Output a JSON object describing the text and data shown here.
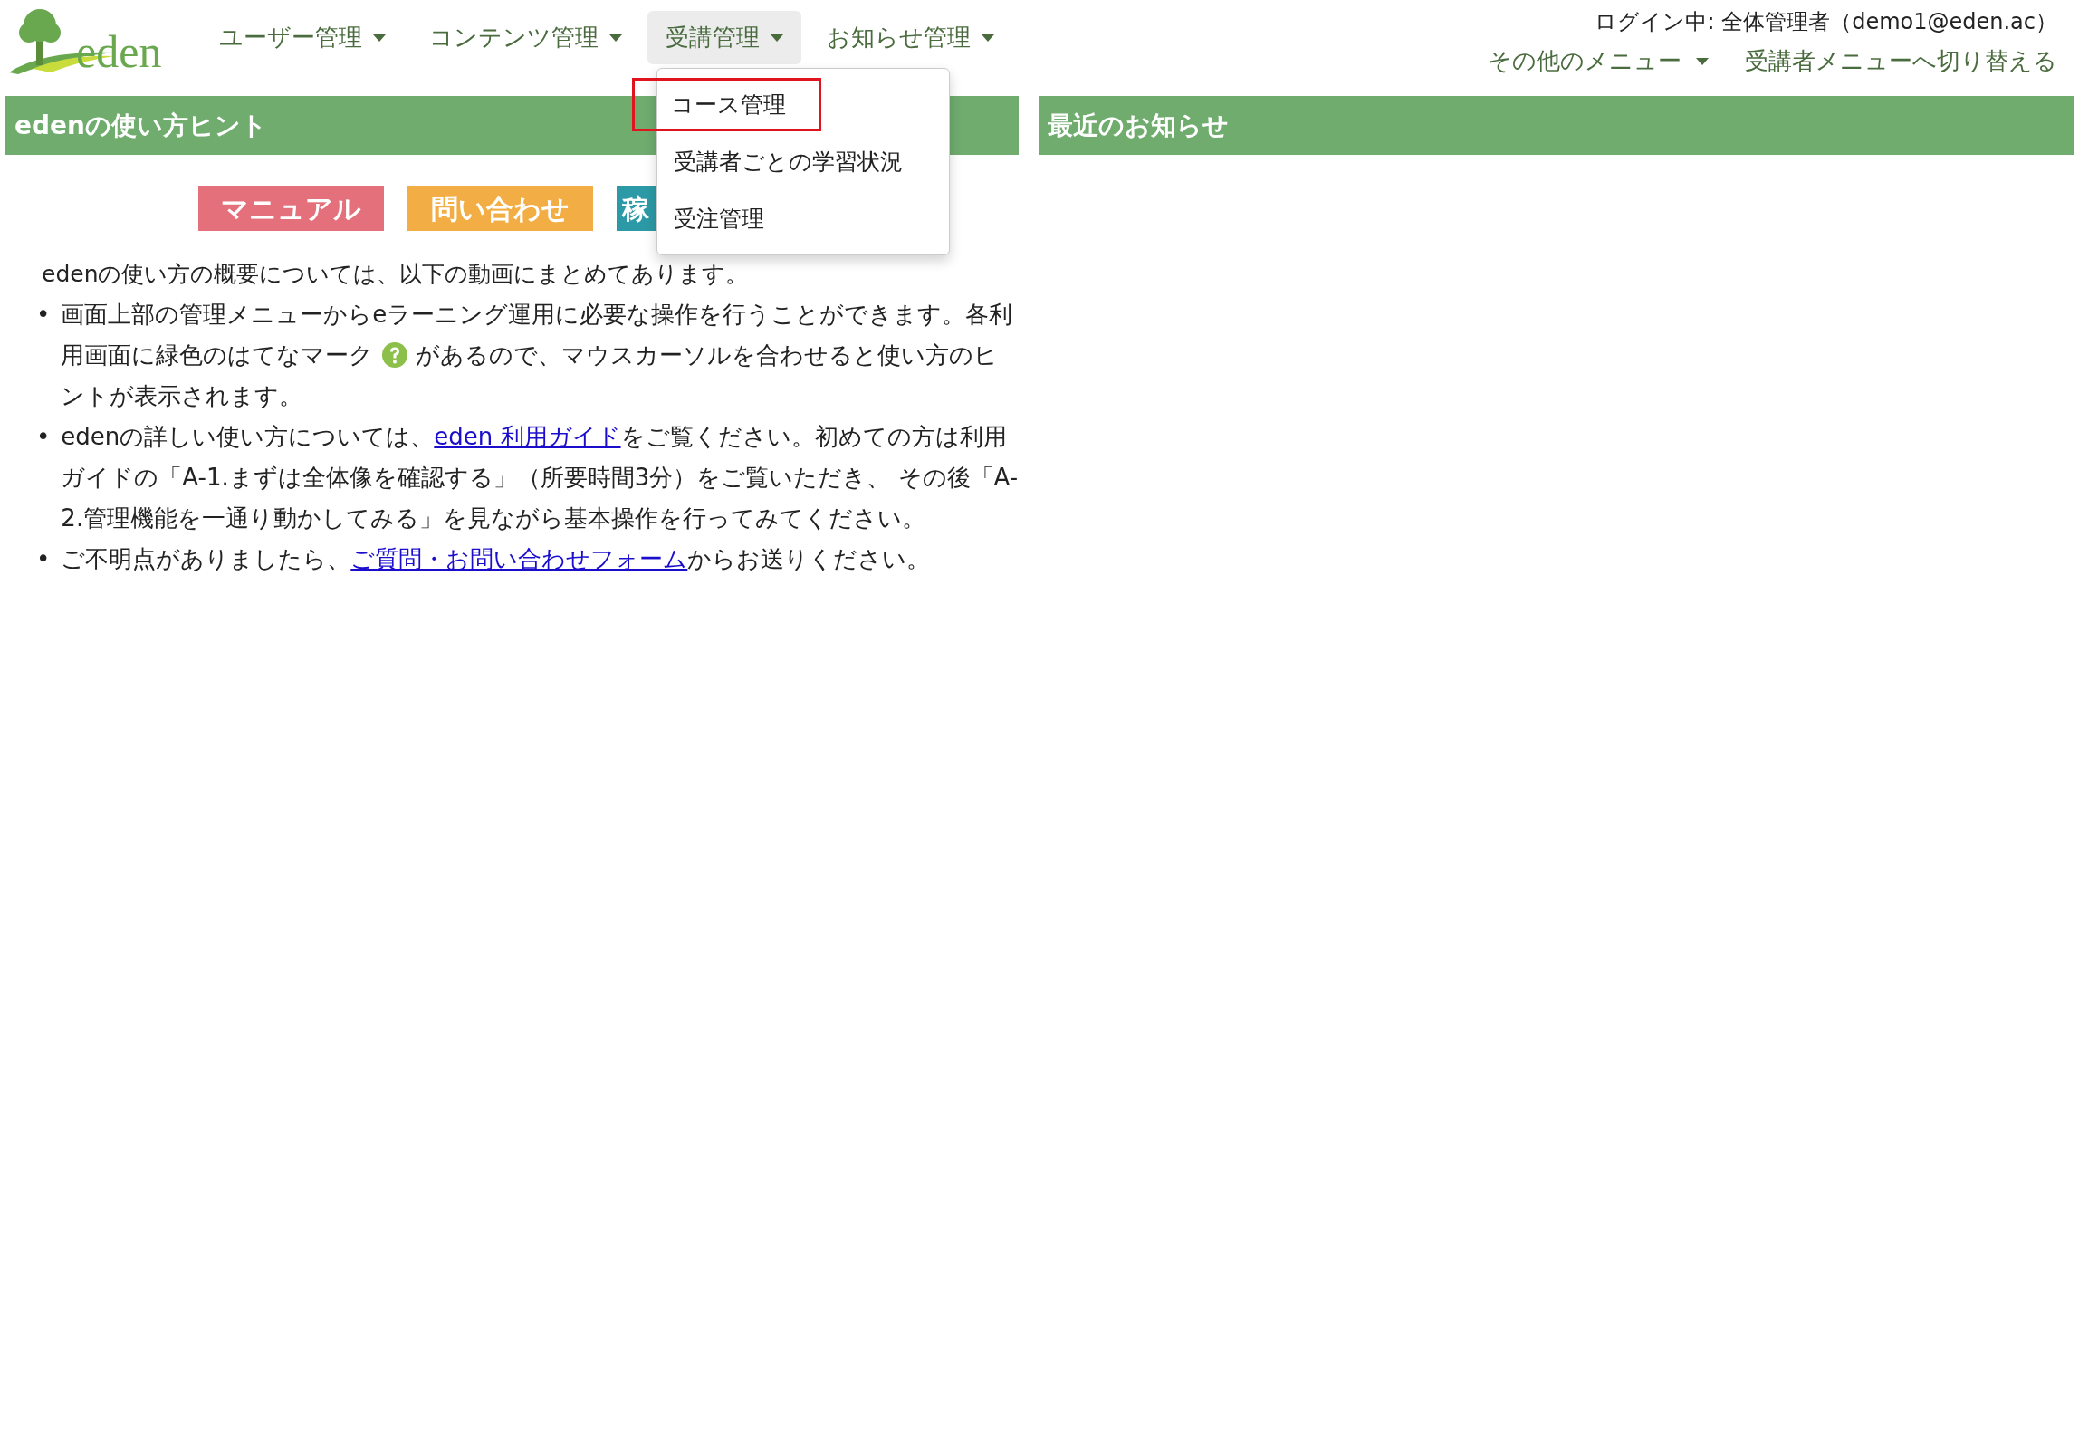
{
  "logo": {
    "text": "eden"
  },
  "nav": {
    "items": [
      {
        "label": "ユーザー管理",
        "selected": false
      },
      {
        "label": "コンテンツ管理",
        "selected": false
      },
      {
        "label": "受講管理",
        "selected": true
      },
      {
        "label": "お知らせ管理",
        "selected": false
      }
    ]
  },
  "user": {
    "login": "ログイン中: 全体管理者（demo1@eden.ac）"
  },
  "top_links": [
    {
      "label": "その他のメニュー",
      "kind": "dropdown"
    },
    {
      "label": "受講者メニューへ切り替える",
      "kind": "link"
    }
  ],
  "dropdown": {
    "items": [
      {
        "label": "コース管理",
        "highlighted": true
      },
      {
        "label": "受講者ごとの学習状況",
        "highlighted": false
      },
      {
        "label": "受注管理",
        "highlighted": false
      }
    ]
  },
  "hints": {
    "title": "edenの使い方ヒント",
    "buttons": [
      {
        "label": "マニュアル",
        "color": "#e3707a"
      },
      {
        "label": "問い合わせ",
        "color": "#f2ae45"
      },
      {
        "label": "稼",
        "color": "#2b9aa6"
      }
    ],
    "intro": "edenの使い方の概要については、以下の動画にまとめてあります。",
    "bullets": [
      {
        "marker": "•",
        "segments": [
          {
            "kind": "text",
            "text": "画面上部の管理メニューからeラーニング運用に必要な操作を行うことができます。各利用画面に緑色のはてなマーク "
          },
          {
            "kind": "help_icon"
          },
          {
            "kind": "text",
            "text": " があるので、マウスカーソルを合わせると使い方のヒントが表示されます。"
          }
        ]
      },
      {
        "marker": "•",
        "segments": [
          {
            "kind": "text",
            "text": "edenの詳しい使い方については、"
          },
          {
            "kind": "link",
            "text": "eden 利用ガイド"
          },
          {
            "kind": "text",
            "text": "をご覧ください。初めての方は利用ガイドの「A-1.まずは全体像を確認する」（所要時間3分）をご覧いただき、 その後「A-2.管理機能を一通り動かしてみる」を見ながら基本操作を行ってみてください。"
          }
        ]
      },
      {
        "marker": "•",
        "segments": [
          {
            "kind": "text",
            "text": "ご不明点がありましたら、"
          },
          {
            "kind": "link",
            "text": "ご質問・お問い合わせフォーム"
          },
          {
            "kind": "text",
            "text": "からお送りください。"
          }
        ]
      }
    ]
  },
  "news": {
    "title": "最近のお知らせ"
  }
}
